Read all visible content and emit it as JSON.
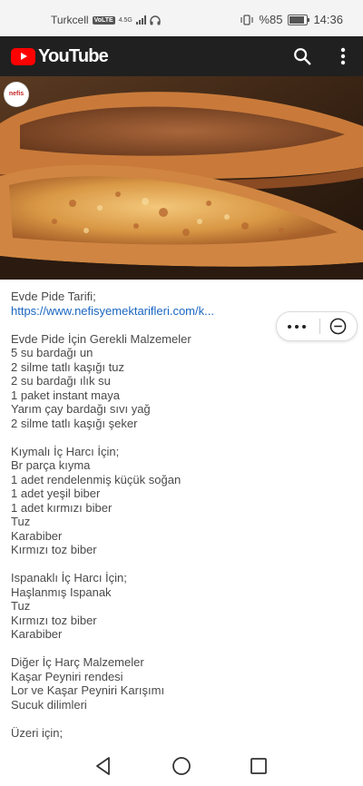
{
  "status_bar": {
    "carrier": "Turkcell",
    "volte": "VoLTE",
    "network": "4.5G",
    "battery_percent": "%85",
    "battery_level": 0.85,
    "time": "14:36"
  },
  "header": {
    "logo_text": "YouTube",
    "search_icon": "search-icon",
    "menu_icon": "more-vert-icon"
  },
  "video": {
    "channel_watermark": "nefis"
  },
  "description": {
    "lines": [
      "Evde Pide Tarifi;",
      "https://www.nefisyemektarifleri.com/k...",
      "",
      "Evde Pide İçin Gerekli Malzemeler",
      "5 su bardağı un",
      "2 silme tatlı kaşığı tuz",
      "2 su bardağı ılık su",
      "1 paket instant maya",
      "Yarım çay bardağı sıvı yağ",
      "2 silme tatlı kaşığı şeker",
      "",
      "Kıymalı İç Harcı İçin;",
      "Br parça kıyma",
      "1 adet rendelenmiş küçük soğan",
      "1 adet yeşil biber",
      "1 adet kırmızı biber",
      "Tuz",
      "Karabiber",
      "Kırmızı toz biber",
      "",
      "Ispanaklı İç Harcı İçin;",
      "Haşlanmış Ispanak",
      "Tuz",
      "Kırmızı toz biber",
      "Karabiber",
      "",
      "Diğer İç Harç Malzemeler",
      "Kaşar Peyniri rendesi",
      "Lor ve Kaşar Peyniri Karışımı",
      "Sucuk dilimleri",
      "",
      "Üzeri için;"
    ]
  },
  "floating_pill": {
    "more_icon": "more-horiz-icon",
    "close_icon": "minus-circle-icon"
  },
  "nav_bar": {
    "back_icon": "back-icon",
    "home_icon": "home-icon",
    "recent_icon": "recent-apps-icon"
  },
  "colors": {
    "youtube_red": "#ff0000",
    "header_bg": "#202020",
    "link": "#1a66c2"
  }
}
